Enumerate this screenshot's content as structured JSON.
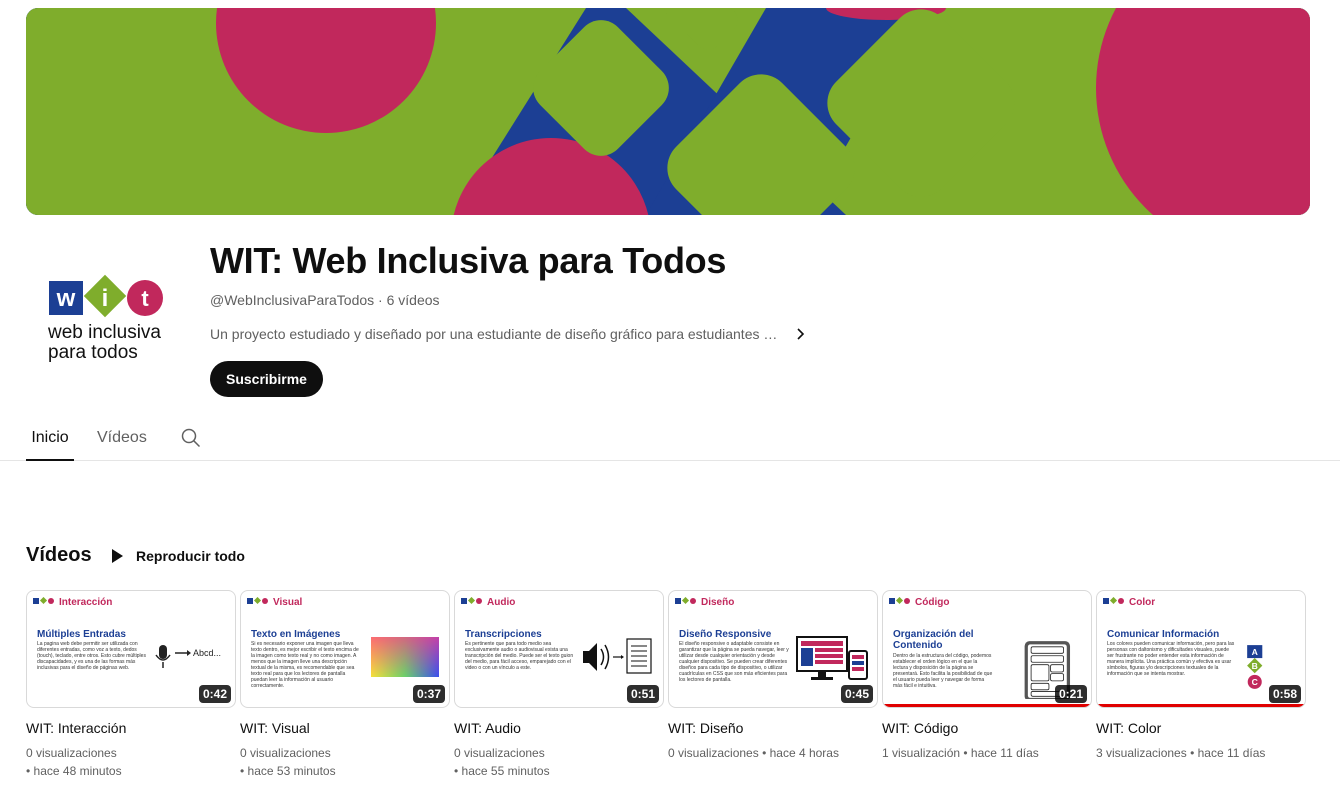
{
  "channel": {
    "title": "WIT: Web Inclusiva para Todos",
    "handle": "@WebInclusivaParaTodos",
    "video_count": "6 vídeos",
    "description": "Un proyecto estudiado y diseñado por una estudiante de diseño gráfico para estudiantes de diseño web",
    "subscribe_label": "Suscribirme",
    "logo_line1": "web inclusiva",
    "logo_line2": "para todos"
  },
  "tabs": [
    {
      "label": "Inicio",
      "active": true
    },
    {
      "label": "Vídeos",
      "active": false
    }
  ],
  "shelf": {
    "title": "Vídeos",
    "play_all_label": "Reproducir todo"
  },
  "videos": [
    {
      "title": "WIT: Interacción",
      "duration": "0:42",
      "views": "0 visualizaciones",
      "age": "• hace 48 minutos",
      "thumb_category": "Interacción",
      "thumb_heading": "Múltiples Entradas",
      "thumb_body": "La pagina web debe permitir ser utilizada con diferentes entradas, como voz a texto, dedos (touch), teclado, entre otros. Esto cubre múltiples discapacidades, y es una de las formas más inclusivas para el diseño de páginas web.",
      "thumb_art_text": "Abcd...",
      "watched_fraction": 0
    },
    {
      "title": "WIT: Visual",
      "duration": "0:37",
      "views": "0 visualizaciones",
      "age": "• hace 53 minutos",
      "thumb_category": "Visual",
      "thumb_heading": "Texto en Imágenes",
      "thumb_body": "Si es necesario exponer una imagen que lleva texto dentro, es mejor escribir el texto encima de la imagen como texto real y no como imagen. A menos que la imagen lleve una descripción textual de la misma, es recomendable que sea texto real para que los lectores de pantalla puedan leer la información al usuario correctamente.",
      "thumb_art_text": "",
      "watched_fraction": 0
    },
    {
      "title": "WIT: Audio",
      "duration": "0:51",
      "views": "0 visualizaciones",
      "age": "• hace 55 minutos",
      "thumb_category": "Audio",
      "thumb_heading": "Transcripciones",
      "thumb_body": "Es pertinente que para todo medio sea exclusivamente audio o audiovisual exista una transcripción del medio. Puede ser el texto guion del medio, para fácil acceso, emparejado con el video o con un vínculo a este.",
      "thumb_art_text": "",
      "watched_fraction": 0
    },
    {
      "title": "WIT: Diseño",
      "duration": "0:45",
      "views": "0 visualizaciones",
      "age": "• hace 4 horas",
      "thumb_category": "Diseño",
      "thumb_heading": "Diseño Responsive",
      "thumb_body": "El diseño responsive o adaptable consiste en garantizar que la página se pueda navegar, leer y utilizar desde cualquier orientación y desde cualquier dispositivo. Se pueden crear diferentes diseños para cada tipo de dispositivo, o utilizar cuadrículas en CSS que son más eficientes para los lectores de pantalla.",
      "thumb_art_text": "",
      "watched_fraction": 0
    },
    {
      "title": "WIT: Código",
      "duration": "0:21",
      "views": "1 visualización",
      "age": "• hace 11 días",
      "thumb_category": "Código",
      "thumb_heading": "Organización del Contenido",
      "thumb_body": "Dentro de la estructura del código, podemos establecer el orden lógico en el que la lectura y disposición de la página se presentará. Esto facilita la posibilidad de que el usuario pueda leer y navegar de forma más fácil e intuitiva.",
      "thumb_art_text": "",
      "watched_fraction": 1
    },
    {
      "title": "WIT: Color",
      "duration": "0:58",
      "views": "3 visualizaciones",
      "age": "• hace 11 días",
      "thumb_category": "Color",
      "thumb_heading": "Comunicar Información",
      "thumb_body": "Los colores pueden comunicar información, pero para las personas con daltonismo y dificultades visuales, puede ser frustrante no poder entender esta información de manera implícita. Una práctica común y efectiva es usar símbolos, figuras y/o descripciones textuales de la información que se intenta mostrar.",
      "thumb_art_text": "",
      "watched_fraction": 1
    }
  ],
  "colors": {
    "brand_blue": "#1c3f94",
    "brand_green": "#7fad2c",
    "brand_pink": "#c1285c",
    "progress_red": "#e00000"
  }
}
